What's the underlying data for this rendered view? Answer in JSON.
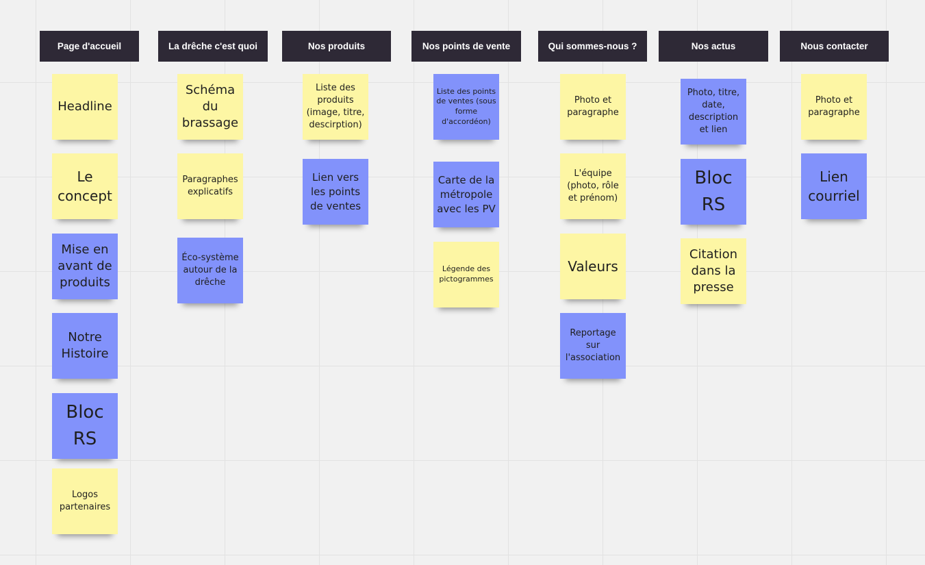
{
  "headers": {
    "accueil": "Page d'accueil",
    "dreche": "La drêche c'est quoi",
    "produits": "Nos produits",
    "points_vente": "Nos points de vente",
    "qui": "Qui sommes-nous ?",
    "actus": "Nos actus",
    "contact": "Nous contacter"
  },
  "notes": {
    "accueil": [
      "Headline",
      "Le concept",
      "Mise en avant de produits",
      "Notre Histoire",
      "Bloc RS",
      "Logos partenaires"
    ],
    "dreche": [
      "Schéma du brassage",
      "Paragraphes explicatifs",
      "Éco-système autour de la drêche"
    ],
    "produits": [
      "Liste des produits (image, titre, descirption)",
      "Lien vers les points de ventes"
    ],
    "points_vente": [
      "Liste des points de ventes (sous forme d'accordéon)",
      "Carte de la métropole avec les PV",
      "Légende des pictogrammes"
    ],
    "qui": [
      "Photo et paragraphe",
      "L'équipe (photo, rôle et prénom)",
      "Valeurs",
      "Reportage sur l'association"
    ],
    "actus": [
      "Photo, titre, date, description et lien",
      "Bloc RS",
      "Citation dans la presse"
    ],
    "contact": [
      "Photo et paragraphe",
      "Lien courriel"
    ]
  },
  "colors": {
    "header_bg": "#2e2936",
    "sticky_yellow": "#fdf6a4",
    "sticky_blue": "#8292fb",
    "canvas_bg": "#f1f1f1"
  }
}
